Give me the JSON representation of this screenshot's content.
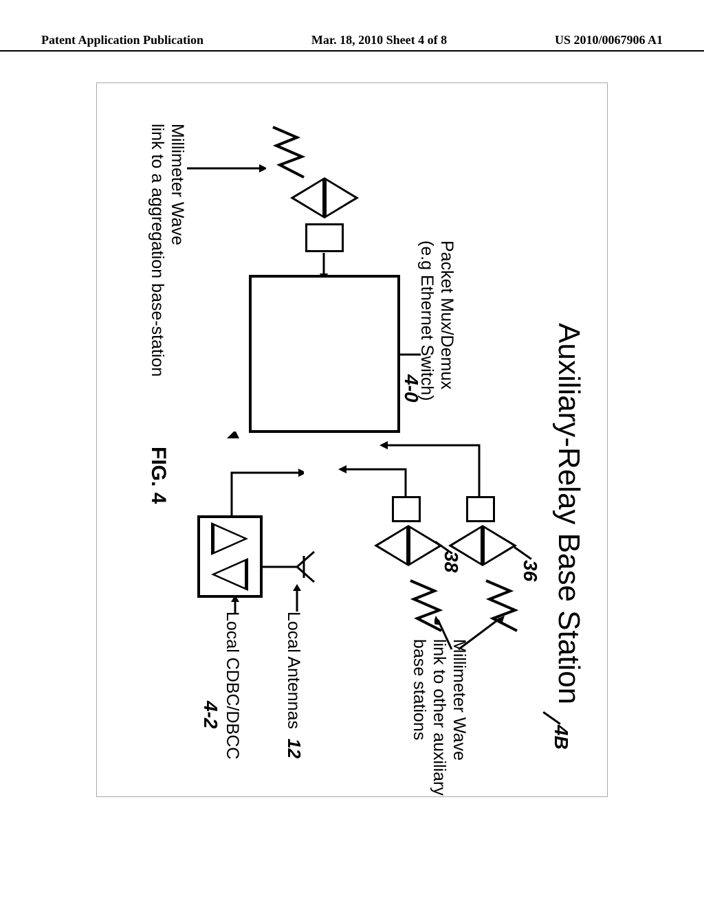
{
  "header": {
    "left": "Patent Application Publication",
    "center": "Mar. 18, 2010  Sheet 4 of 8",
    "right": "US 2010/0067906 A1"
  },
  "diagram": {
    "title": "Auxiliary-Relay Base Station",
    "switch_label_l1": "Packet Mux/Demux",
    "switch_label_l2": "(e.g Ethernet Switch)",
    "mmw_aux_l1": "Millimeter Wave",
    "mmw_aux_l2": "link to other auxiliary",
    "mmw_aux_l3": "base stations",
    "mmw_agg_l1": "Millimeter Wave",
    "mmw_agg_l2": "link to a aggregation base-station",
    "local_antennas": "Local Antennas",
    "local_cdbc": "Local CDBC/DBCC",
    "figure": "FIG. 4"
  },
  "refs": {
    "title": "4B",
    "r36": "36",
    "r38": "38",
    "r40": "4-0",
    "r42": "4-2",
    "r12": "12"
  }
}
